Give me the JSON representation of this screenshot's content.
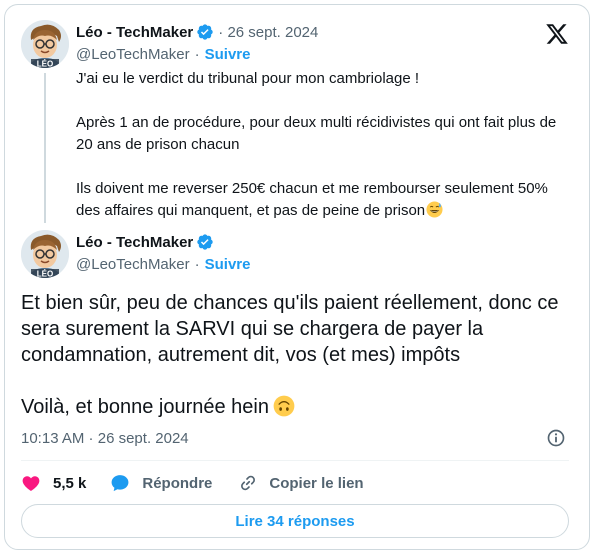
{
  "colors": {
    "accent": "#1d9bf0",
    "text_primary": "#0f1419",
    "text_secondary": "#536471",
    "like": "#f91880",
    "border": "#cfd9de"
  },
  "icons": {
    "brand": "x-logo-icon",
    "verified": "verified-badge-icon",
    "info": "info-icon",
    "like": "heart-icon",
    "reply": "speech-bubble-icon",
    "copy": "link-icon"
  },
  "quoted_tweet": {
    "author_name": "Léo - TechMaker",
    "date": "26 sept. 2024",
    "handle": "@LeoTechMaker",
    "separator": "·",
    "follow_label": "Suivre",
    "avatar_text": "LÉO",
    "paragraphs": [
      "J'ai eu le verdict du tribunal pour mon cambriolage !",
      "Après 1 an de procédure, pour deux multi récidivistes qui ont fait plus de 20 ans de prison chacun",
      "Ils doivent me reverser 250€ chacun et me rembourser seulement 50% des affaires qui manquent, et pas de peine de prison"
    ]
  },
  "main_tweet": {
    "author_name": "Léo - TechMaker",
    "handle": "@LeoTechMaker",
    "separator": "·",
    "follow_label": "Suivre",
    "avatar_text": "LÉO",
    "paragraphs": [
      "Et bien sûr, peu de chances qu'ils paient réellement, donc ce sera surement la SARVI qui se chargera de payer la condamnation, autrement dit, vos (et mes) impôts",
      "Voilà, et bonne journée hein"
    ],
    "time": "10:13 AM",
    "meta_separator": " · ",
    "date": "26 sept. 2024"
  },
  "actions": {
    "like_count": "5,5 k",
    "reply_label": "Répondre",
    "copy_label": "Copier le lien"
  },
  "read_replies_label": "Lire 34 réponses"
}
